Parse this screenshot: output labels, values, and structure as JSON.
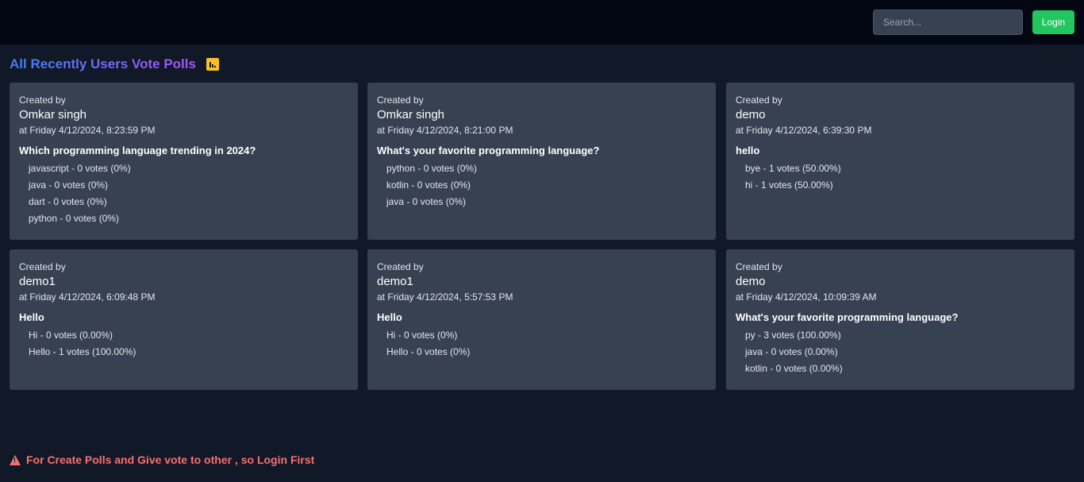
{
  "header": {
    "search_placeholder": "Search...",
    "login_label": "Login"
  },
  "page": {
    "title": "All Recently Users Vote Polls",
    "title_icon": "bar-chart-icon"
  },
  "polls": [
    {
      "created_label": "Created by",
      "creator": "Omkar singh",
      "created_at": "at Friday 4/12/2024, 8:23:59 PM",
      "question": "Which programming language trending in 2024?",
      "options": [
        "javascript - 0 votes (0%)",
        "java - 0 votes (0%)",
        "dart - 0 votes (0%)",
        "python - 0 votes (0%)"
      ]
    },
    {
      "created_label": "Created by",
      "creator": "Omkar singh",
      "created_at": "at Friday 4/12/2024, 8:21:00 PM",
      "question": "What's your favorite programming language?",
      "options": [
        "python - 0 votes (0%)",
        "kotlin - 0 votes (0%)",
        "java - 0 votes (0%)"
      ]
    },
    {
      "created_label": "Created by",
      "creator": "demo",
      "created_at": "at Friday 4/12/2024, 6:39:30 PM",
      "question": "hello",
      "options": [
        "bye - 1 votes (50.00%)",
        "hi - 1 votes (50.00%)"
      ]
    },
    {
      "created_label": "Created by",
      "creator": "demo1",
      "created_at": "at Friday 4/12/2024, 6:09:48 PM",
      "question": "Hello",
      "options": [
        "Hi - 0 votes (0.00%)",
        "Hello - 1 votes (100.00%)"
      ]
    },
    {
      "created_label": "Created by",
      "creator": "demo1",
      "created_at": "at Friday 4/12/2024, 5:57:53 PM",
      "question": "Hello",
      "options": [
        "Hi - 0 votes (0%)",
        "Hello - 0 votes (0%)"
      ]
    },
    {
      "created_label": "Created by",
      "creator": "demo",
      "created_at": "at Friday 4/12/2024, 10:09:39 AM",
      "question": "What's your favorite programming language?",
      "options": [
        "py - 3 votes (100.00%)",
        "java - 0 votes (0.00%)",
        "kotlin - 0 votes (0.00%)"
      ]
    }
  ],
  "footer": {
    "warning_icon": "warning-triangle-icon",
    "warning_text": "For Create Polls and Give vote to other , so Login First",
    "warning_color": "#f87171"
  },
  "colors": {
    "background": "#111827",
    "navbar": "#030712",
    "card": "#374151",
    "login_button": "#22c55e",
    "title_gradient_start": "#3b82f6",
    "title_gradient_end": "#a855f7",
    "icon_accent": "#fbbf24"
  }
}
